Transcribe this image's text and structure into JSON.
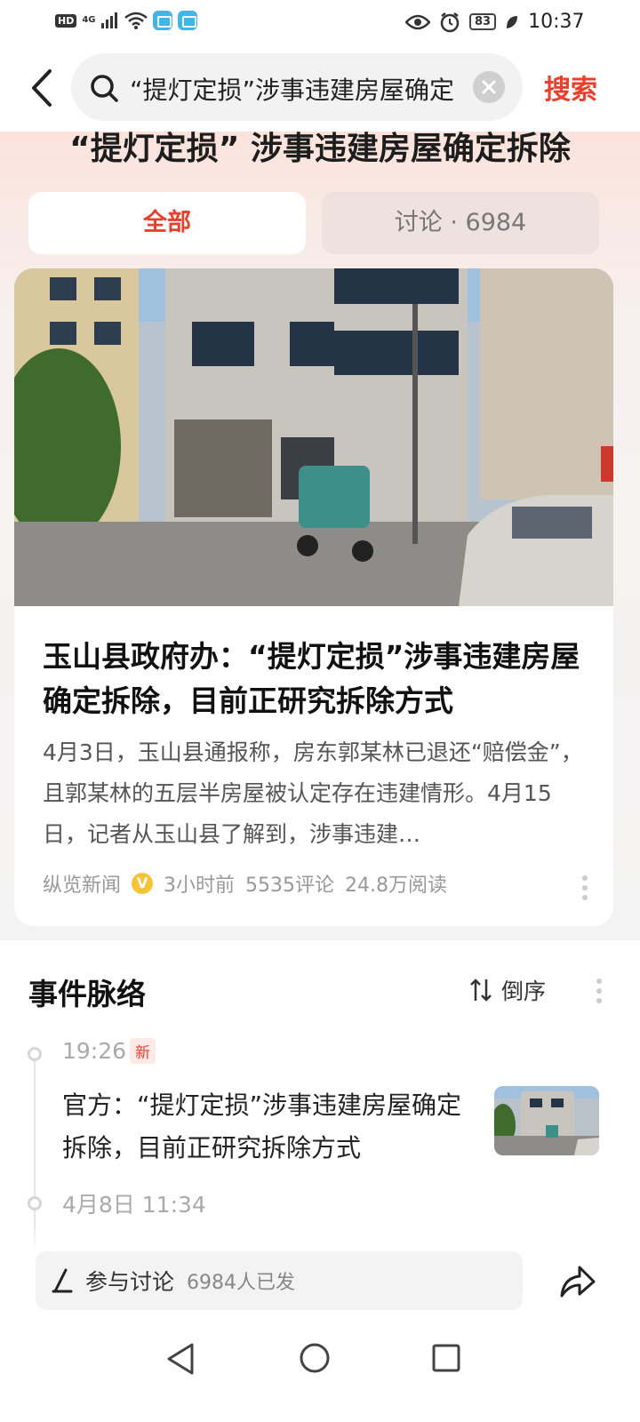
{
  "status_bar": {
    "hd": "HD",
    "network": "4G",
    "battery": "83",
    "time": "10:37"
  },
  "search": {
    "query": "“提灯定损”涉事违建房屋确定",
    "button_label": "搜索"
  },
  "topic": {
    "title": "“提灯定损” 涉事违建房屋确定拆除",
    "tabs": [
      {
        "label": "全部"
      },
      {
        "label": "讨论 · 6984"
      }
    ]
  },
  "news": {
    "headline": "玉山县政府办：“提灯定损”涉事违建房屋确定拆除，目前正研究拆除方式",
    "summary": "4月3日，玉山县通报称，房东郭某林已退还“赔偿金”，且郭某林的五层半房屋被认定存在违建情形。4月15日，记者从玉山县了解到，涉事违建…",
    "source": "纵览新闻",
    "time": "3小时前",
    "comments": "5535评论",
    "reads": "24.8万阅读"
  },
  "timeline": {
    "title": "事件脉络",
    "sort_label": "倒序",
    "items": [
      {
        "time": "19:26",
        "badge": "新",
        "text": "官方：“提灯定损”涉事违建房屋确定拆除，目前正研究拆除方式"
      },
      {
        "time": "4月8日 11:34"
      }
    ]
  },
  "bottom_bar": {
    "discuss_label": "参与讨论",
    "discuss_count": "6984人已发"
  },
  "colors": {
    "accent": "#e8402f",
    "header_gradient": "#fbe3dc"
  }
}
